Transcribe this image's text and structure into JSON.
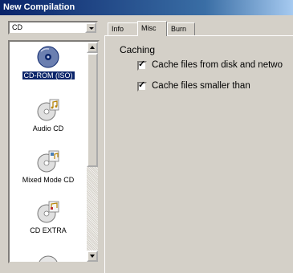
{
  "window": {
    "title": "New Compilation"
  },
  "format_select": {
    "value": "CD"
  },
  "compilation_types": [
    {
      "label": "CD-ROM (ISO)",
      "icon": "cd-rom-iso-icon",
      "selected": true
    },
    {
      "label": "Audio CD",
      "icon": "audio-cd-icon",
      "selected": false
    },
    {
      "label": "Mixed Mode CD",
      "icon": "mixed-mode-cd-icon",
      "selected": false
    },
    {
      "label": "CD EXTRA",
      "icon": "cd-extra-icon",
      "selected": false
    },
    {
      "label": "",
      "icon": "cd-icon",
      "selected": false
    }
  ],
  "tabs": [
    {
      "label": "Info",
      "active": false
    },
    {
      "label": "Misc",
      "active": true
    },
    {
      "label": "Burn",
      "active": false
    }
  ],
  "misc": {
    "section_title": "Caching",
    "options": [
      {
        "label": "Cache files from disk and netwo",
        "checked": true
      },
      {
        "label": "Cache files smaller than",
        "checked": true
      }
    ]
  },
  "colors": {
    "titlebar": "#0a246a",
    "face": "#d4d0c8",
    "selection": "#0a246a"
  }
}
